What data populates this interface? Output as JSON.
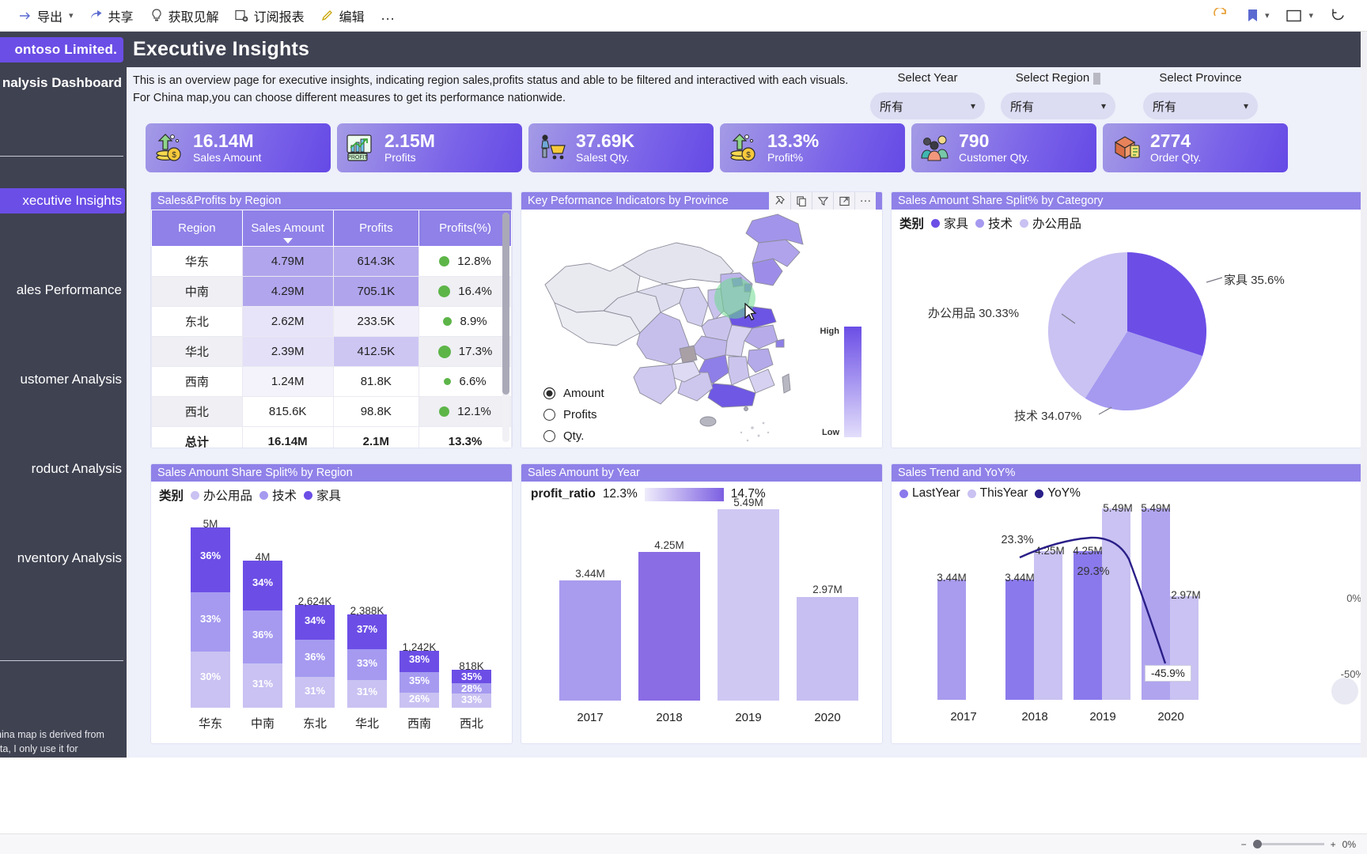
{
  "commandbar": {
    "items": [
      {
        "label": "导出",
        "icon": "export-icon",
        "caret": true
      },
      {
        "label": "共享",
        "icon": "share-icon",
        "caret": false
      },
      {
        "label": "获取见解",
        "icon": "lightbulb-icon",
        "caret": false
      },
      {
        "label": "订阅报表",
        "icon": "subscribe-icon",
        "caret": false
      },
      {
        "label": "编辑",
        "icon": "pencil-icon",
        "caret": false
      }
    ],
    "more_label": "...",
    "right_icons": [
      "reset-icon",
      "bookmark-icon",
      "view-icon",
      "refresh-icon"
    ]
  },
  "sidebar": {
    "brand": "ontoso Limited.",
    "subtitle": "nalysis Dashboard",
    "items": [
      {
        "label": "xecutive  Insights",
        "active": true
      },
      {
        "label": "ales Performance",
        "active": false
      },
      {
        "label": "ustomer Analysis",
        "active": false
      },
      {
        "label": "roduct    Analysis",
        "active": false
      },
      {
        "label": "nventory Analysis",
        "active": false
      }
    ],
    "footnote": "China map is derived from\ndata, I only use it for\npurpose without any\nnation."
  },
  "report": {
    "title": "Executive Insights",
    "intro": "This is an overview page for executive insights, indicating region sales,profits status and able to be filtered and interactived with each visuals. For China map,you can choose different measures to get its performance nationwide."
  },
  "slicers": [
    {
      "label": "Select Year",
      "value": "所有"
    },
    {
      "label": "Select Region",
      "value": "所有"
    },
    {
      "label": "Select Province",
      "value": "所有"
    }
  ],
  "kpis": [
    {
      "value": "16.14M",
      "caption": "Sales Amount",
      "icon": "money-growth-icon"
    },
    {
      "value": "2.15M",
      "caption": "Profits",
      "icon": "profit-chart-icon"
    },
    {
      "value": "37.69K",
      "caption": "Salest Qty.",
      "icon": "shopping-cart-icon"
    },
    {
      "value": "13.3%",
      "caption": "Profit%",
      "icon": "money-growth-icon"
    },
    {
      "value": "790",
      "caption": "Customer Qty.",
      "icon": "customers-icon"
    },
    {
      "value": "2774",
      "caption": "Order Qty.",
      "icon": "package-icon"
    }
  ],
  "table_visual": {
    "title": "Sales&Profits by Region",
    "columns": [
      "Region",
      "Sales Amount",
      "Profits",
      "Profits(%)"
    ],
    "sorted_column": "Sales Amount",
    "rows": [
      {
        "region": "华东",
        "sales": "4.79M",
        "profits": "614.3K",
        "pct": "12.8%",
        "dot": 13
      },
      {
        "region": "中南",
        "sales": "4.29M",
        "profits": "705.1K",
        "pct": "16.4%",
        "dot": 15
      },
      {
        "region": "东北",
        "sales": "2.62M",
        "profits": "233.5K",
        "pct": "8.9%",
        "dot": 11
      },
      {
        "region": "华北",
        "sales": "2.39M",
        "profits": "412.5K",
        "pct": "17.3%",
        "dot": 16
      },
      {
        "region": "西南",
        "sales": "1.24M",
        "profits": "81.8K",
        "pct": "6.6%",
        "dot": 9
      },
      {
        "region": "西北",
        "sales": "815.6K",
        "profits": "98.8K",
        "pct": "12.1%",
        "dot": 13
      }
    ],
    "total": {
      "region": "总计",
      "sales": "16.14M",
      "profits": "2.1M",
      "pct": "13.3%"
    }
  },
  "map_visual": {
    "title": "Key Peformance Indicators by Province",
    "actions": [
      "pin-icon",
      "copy-icon",
      "filter-icon",
      "focus-icon",
      "more-icon"
    ],
    "measures": [
      {
        "label": "Amount",
        "selected": true
      },
      {
        "label": "Profits",
        "selected": false
      },
      {
        "label": "Qty.",
        "selected": false
      }
    ],
    "legend_high": "High",
    "legend_low": "Low"
  },
  "pie_visual": {
    "title": "Sales Amount Share Split% by Category",
    "legend_title": "类别",
    "chart_data": {
      "type": "pie",
      "title": "Sales Amount Share Split% by Category",
      "categories": [
        "家具",
        "技术",
        "办公用品"
      ],
      "values": [
        35.6,
        34.07,
        30.33
      ],
      "labels": [
        "家具 35.6%",
        "技术 34.07%",
        "办公用品 30.33%"
      ],
      "colors": [
        "#6c4ee6",
        "#a59af0",
        "#c9c2f2"
      ],
      "legend_position": "top"
    }
  },
  "stacked_visual": {
    "title": "Sales Amount Share Split% by Region",
    "legend_title": "类别",
    "chart_data": {
      "type": "bar",
      "title": "Sales Amount Share Split% by Region",
      "categories": [
        "华东",
        "中南",
        "东北",
        "华北",
        "西南",
        "西北"
      ],
      "totals": [
        "5M",
        "4M",
        "2,624K",
        "2,388K",
        "1,242K",
        "818K"
      ],
      "total_values": [
        5000,
        4000,
        2624,
        2388,
        1242,
        818
      ],
      "series": [
        {
          "name": "家具",
          "color": "#6c4ee6",
          "values": [
            36,
            34,
            34,
            37,
            38,
            35
          ]
        },
        {
          "name": "技术",
          "color": "#a59af0",
          "values": [
            33,
            36,
            36,
            33,
            35,
            28
          ]
        },
        {
          "name": "办公用品",
          "color": "#c9c2f2",
          "values": [
            30,
            31,
            31,
            31,
            26,
            33
          ]
        }
      ],
      "legend_entries": [
        "办公用品",
        "技术",
        "家具"
      ],
      "legend_colors": [
        "#c9c2f2",
        "#a59af0",
        "#6c4ee6"
      ],
      "xlabel": "",
      "ylabel": ""
    }
  },
  "year_visual": {
    "title": "Sales Amount by Year",
    "gradient_legend": {
      "name": "profit_ratio",
      "min": "12.3%",
      "max": "14.7%"
    },
    "chart_data": {
      "type": "bar",
      "title": "Sales Amount by Year",
      "categories": [
        "2017",
        "2018",
        "2019",
        "2020"
      ],
      "values": [
        3.44,
        4.25,
        5.49,
        2.97
      ],
      "labels": [
        "3.44M",
        "4.25M",
        "5.49M",
        "2.97M"
      ],
      "colors": [
        "#a99bee",
        "#8a6ce4",
        "#cfc8f3",
        "#c7bff1"
      ],
      "ylabel": "Sales Amount",
      "xlabel": "Year"
    }
  },
  "trend_visual": {
    "title": "Sales Trend and YoY%",
    "chart_data": {
      "type": "line",
      "title": "Sales Trend and YoY%",
      "categories": [
        "2017",
        "2018",
        "2019",
        "2020"
      ],
      "legend_entries": [
        "LastYear",
        "ThisYear",
        "YoY%"
      ],
      "legend_colors": [
        "#8a79ec",
        "#c9c2f2",
        "#2a1f88"
      ],
      "series": [
        {
          "name": "LastYear",
          "values": [
            3.44,
            4.25,
            4.25,
            5.49
          ],
          "labels": [
            "3.44M",
            "4.25M",
            "4.25M",
            "5.49M"
          ]
        },
        {
          "name": "ThisYear",
          "values": [
            3.44,
            4.25,
            5.49,
            2.97
          ],
          "labels": [
            "3.44M",
            "4.25M",
            "5.49M",
            "2.97M"
          ]
        },
        {
          "name": "YoY%",
          "values": [
            null,
            23.3,
            29.3,
            -45.9
          ],
          "labels": [
            "",
            "23.3%",
            "29.3%",
            "-45.9%"
          ]
        }
      ],
      "right_axis_ticks": [
        "0%",
        "-50%"
      ],
      "callout": "-45.9%"
    }
  },
  "statusbar": {
    "zoom": "0%"
  }
}
